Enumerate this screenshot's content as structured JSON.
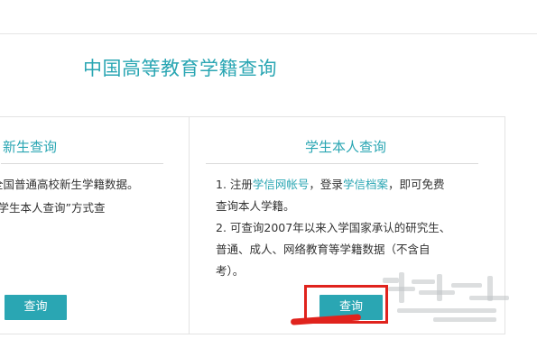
{
  "page": {
    "title": "中国高等教育学籍查询"
  },
  "left_card": {
    "title": "新生查询",
    "lines": [
      "全国普通高校新生学籍数据。",
      "“学生本人查询”方式查"
    ],
    "button": "查询"
  },
  "right_card": {
    "title": "学生本人查询",
    "line1": {
      "pre": "1. 注册",
      "link1": "学信网帐号",
      "mid": "，登录",
      "link2": "学信档案",
      "post": "，即可免费"
    },
    "lines": [
      "查询本人学籍。",
      "2. 可查询2007年以来入学国家承认的研究生、",
      "普通、成人、网络教育等学籍数据（不含自",
      "考）。"
    ],
    "button": "查询"
  },
  "colors": {
    "accent": "#2aa6b3",
    "highlight": "#e0231d"
  }
}
